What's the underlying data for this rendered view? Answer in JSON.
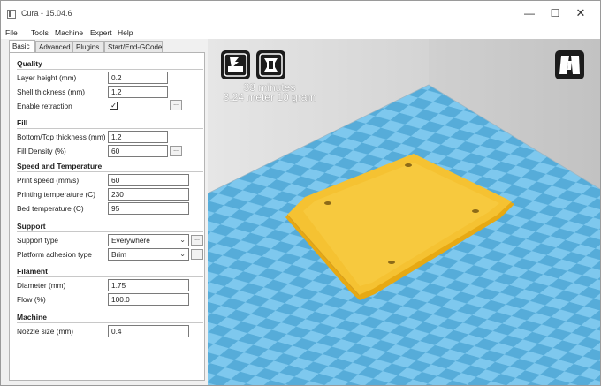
{
  "window": {
    "title": "Cura - 15.04.6",
    "controls": {
      "minimize": "—",
      "maximize": "☐",
      "close": "✕"
    }
  },
  "menu": [
    "File",
    "Tools",
    "Machine",
    "Expert",
    "Help"
  ],
  "tabs": [
    "Basic",
    "Advanced",
    "Plugins",
    "Start/End-GCode"
  ],
  "active_tab": "Basic",
  "sections": {
    "quality": {
      "title": "Quality",
      "layer_height": {
        "label": "Layer height (mm)",
        "value": "0.2"
      },
      "shell_thickness": {
        "label": "Shell thickness (mm)",
        "value": "1.2"
      },
      "enable_retraction": {
        "label": "Enable retraction",
        "checked": true,
        "check_glyph": "✓",
        "more": "..."
      }
    },
    "fill": {
      "title": "Fill",
      "bottom_top_thickness": {
        "label": "Bottom/Top thickness (mm)",
        "value": "1.2"
      },
      "fill_density": {
        "label": "Fill Density (%)",
        "value": "60",
        "more": "..."
      }
    },
    "speed": {
      "title": "Speed and Temperature",
      "print_speed": {
        "label": "Print speed (mm/s)",
        "value": "60"
      },
      "printing_temperature": {
        "label": "Printing temperature (C)",
        "value": "230"
      },
      "bed_temperature": {
        "label": "Bed temperature (C)",
        "value": "95"
      }
    },
    "support": {
      "title": "Support",
      "support_type": {
        "label": "Support type",
        "value": "Everywhere",
        "more": "..."
      },
      "platform_adhesion": {
        "label": "Platform adhesion type",
        "value": "Brim",
        "more": "..."
      }
    },
    "filament": {
      "title": "Filament",
      "diameter": {
        "label": "Diameter (mm)",
        "value": "1.75"
      },
      "flow": {
        "label": "Flow (%)",
        "value": "100.0"
      }
    },
    "machine": {
      "title": "Machine",
      "nozzle_size": {
        "label": "Nozzle size (mm)",
        "value": "0.4"
      }
    }
  },
  "viewport": {
    "print_time": "33 minutes",
    "print_material": "3.24 meter 10 gram",
    "buttons": [
      "load-model-icon",
      "print-settings-icon",
      "view-mode-icon"
    ],
    "colors": {
      "tile_light": "#7ec8ee",
      "tile_dark": "#52a9d9",
      "model": "#f5c232",
      "model_edge": "#d49e1c"
    }
  }
}
